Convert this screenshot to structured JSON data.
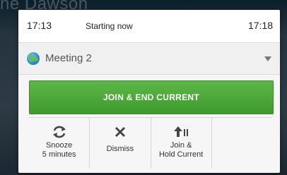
{
  "background_name": "ne Dawson",
  "reminder": {
    "start_time": "17:13",
    "status": "Starting now",
    "end_time": "17:18"
  },
  "meeting": {
    "title": "Meeting 2",
    "icon": "globe-icon"
  },
  "primary_action": {
    "label": "JOIN & END CURRENT",
    "color": "#4caf3a"
  },
  "actions": [
    {
      "label": "Snooze\n5 minutes",
      "icon": "refresh-icon"
    },
    {
      "label": "Dismiss",
      "icon": "close-icon"
    },
    {
      "label": "Join &\nHold Current",
      "icon": "join-hold-icon"
    },
    {
      "label": "",
      "icon": ""
    }
  ]
}
